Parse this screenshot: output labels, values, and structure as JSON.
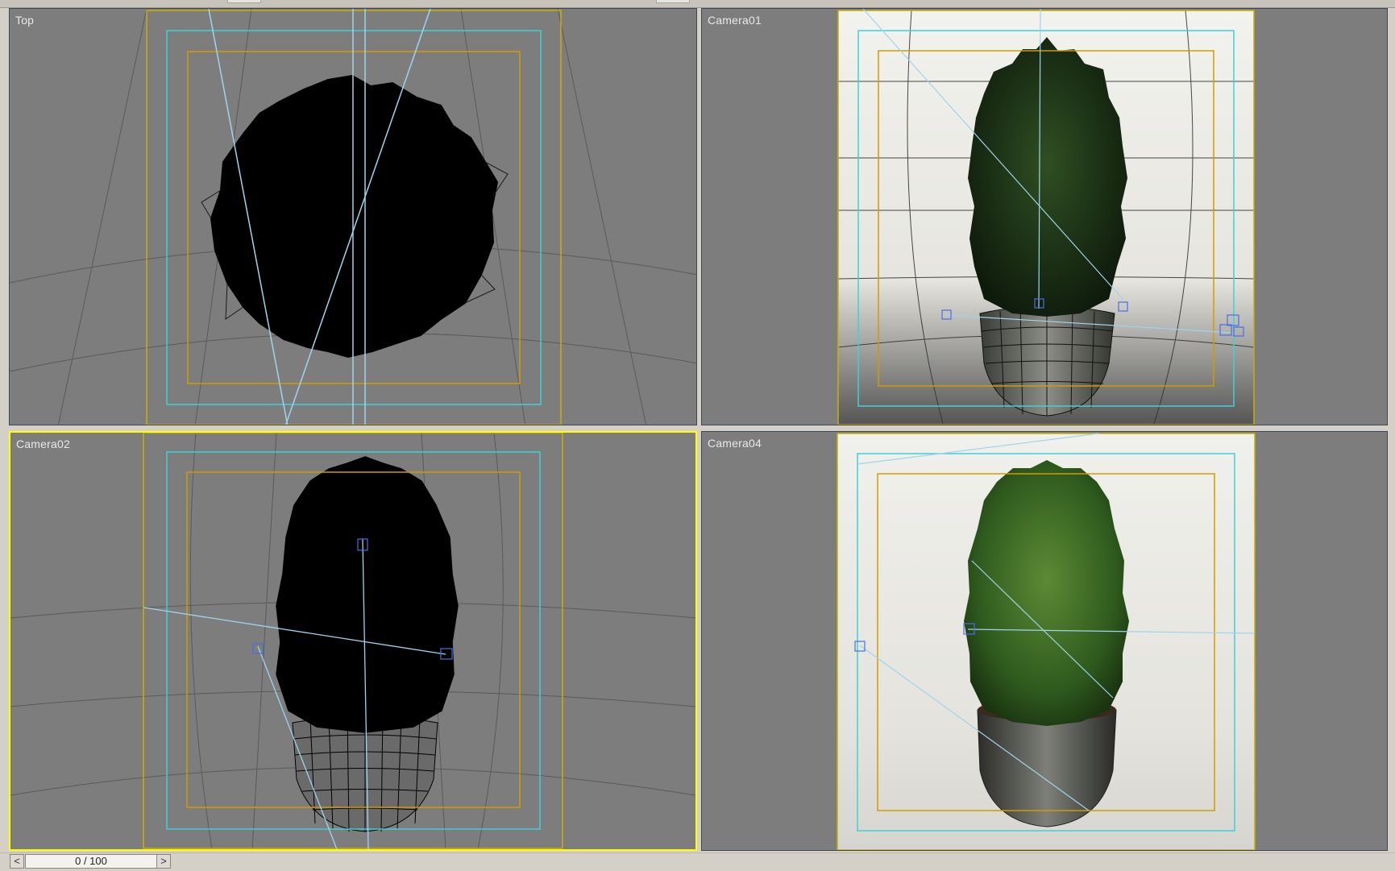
{
  "viewports": {
    "top": {
      "label": "Top"
    },
    "camera01": {
      "label": "Camera01"
    },
    "camera02": {
      "label": "Camera02"
    },
    "camera04": {
      "label": "Camera04"
    }
  },
  "timeslider": {
    "label": "0 / 100",
    "prev_icon": "<",
    "next_icon": ">"
  },
  "colors": {
    "viewport_bg": "#7d7d7d",
    "active_border": "#ffff00",
    "safe_frame_outer": "#c8b000",
    "safe_frame_mid": "#3fd0d8",
    "safe_frame_inner": "#d39a00",
    "camera_line": "#9ed4ec"
  }
}
